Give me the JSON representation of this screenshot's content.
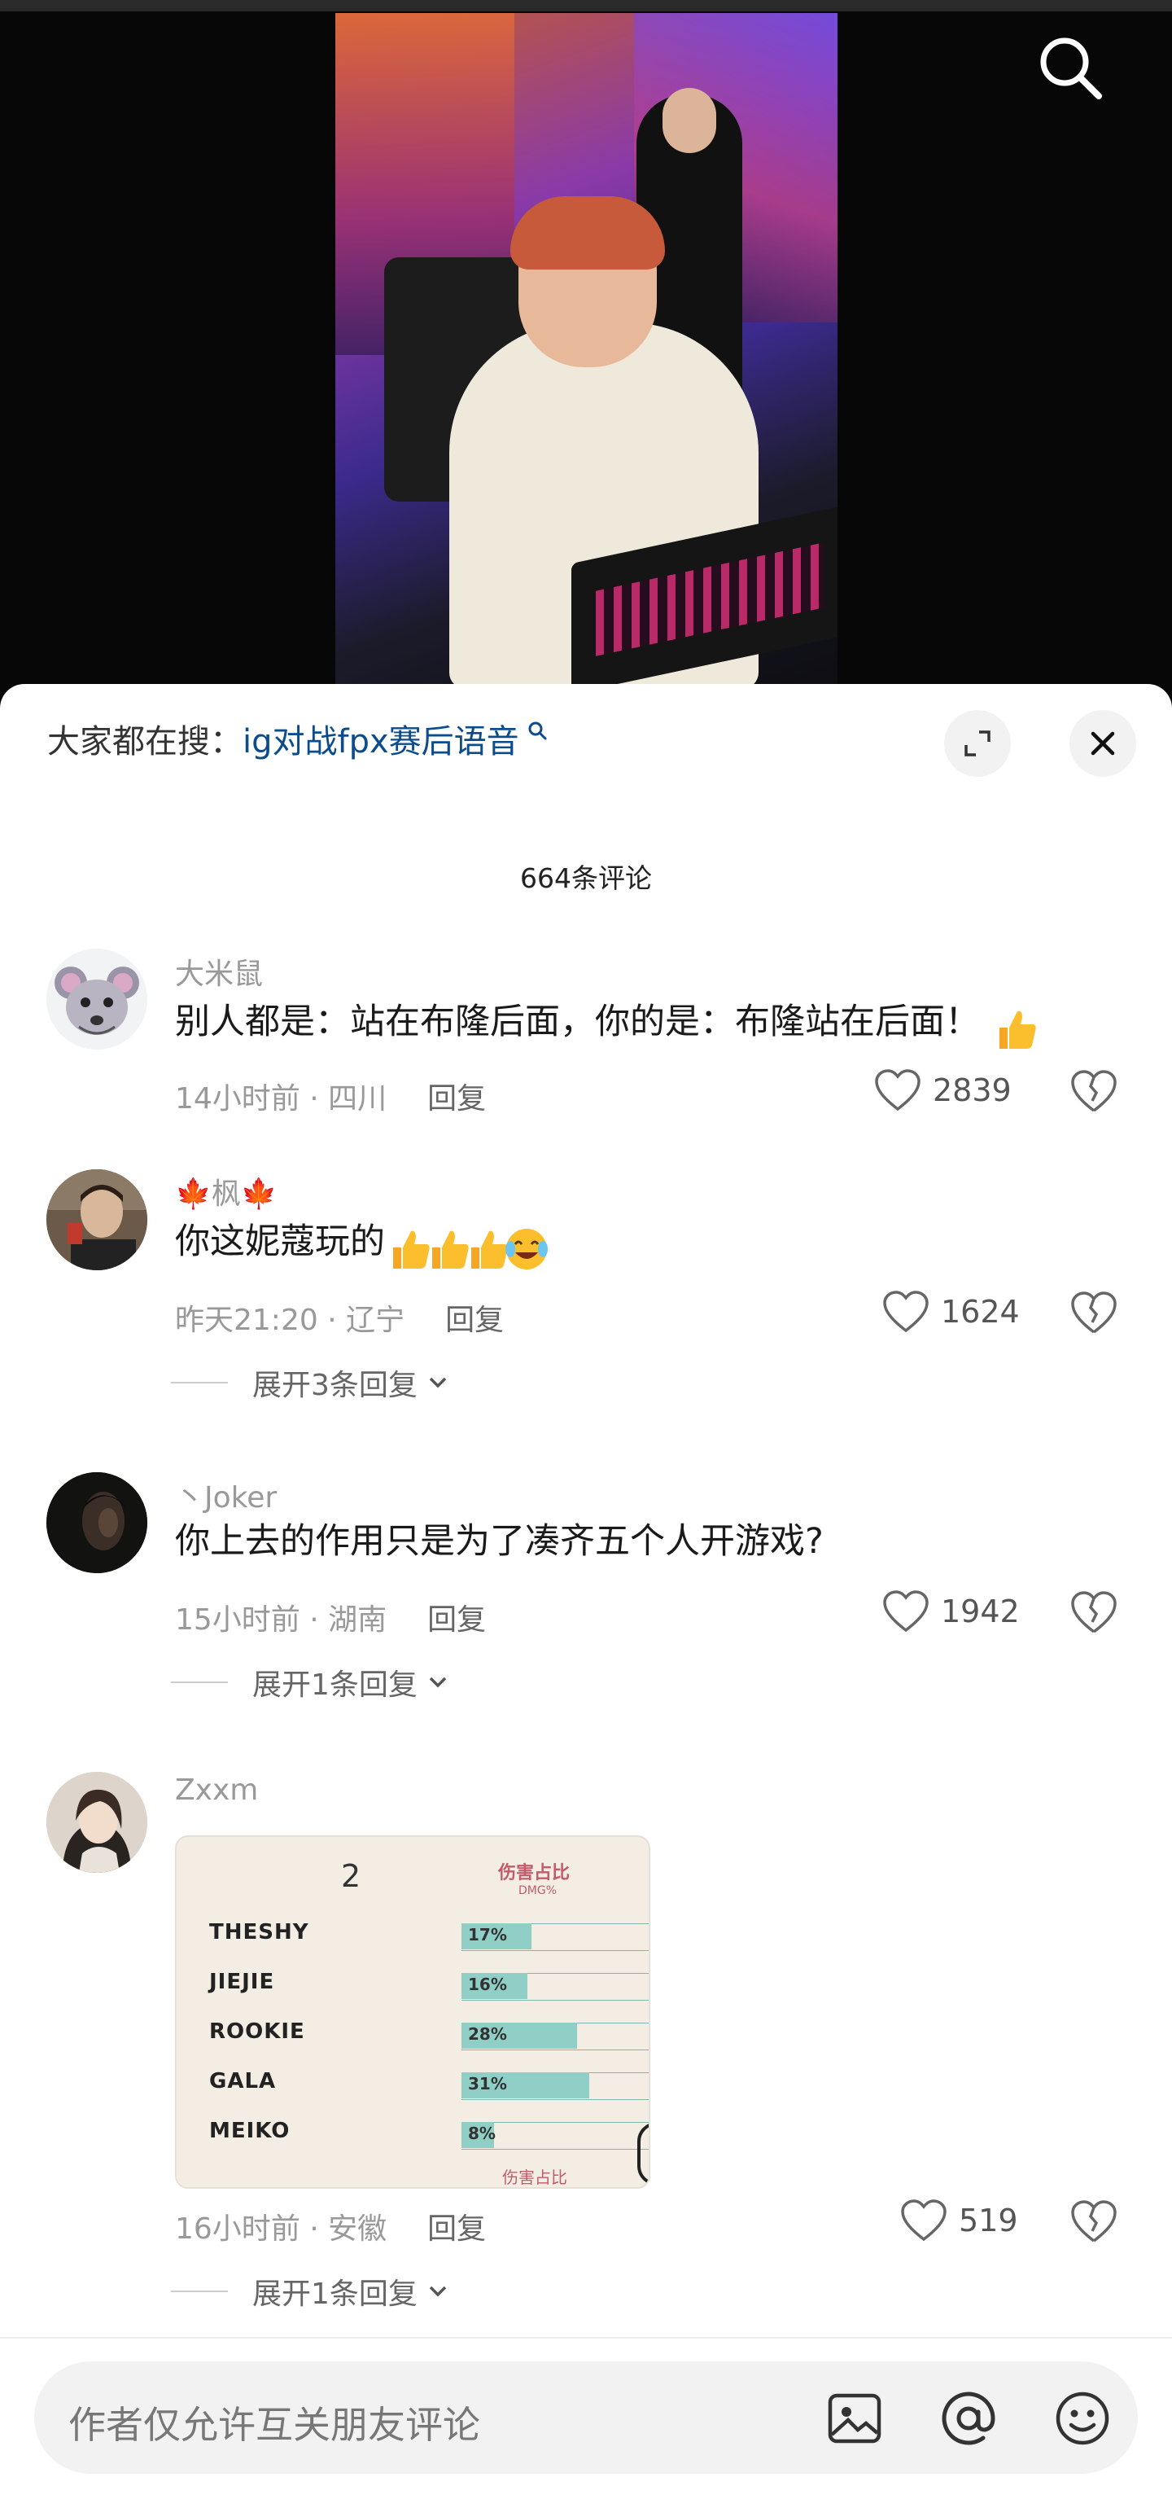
{
  "video": {
    "search_icon": "search-icon"
  },
  "panel": {
    "hot_search_prefix": "大家都在搜：",
    "hot_search_term": "ig对战fpx赛后语音",
    "expand_icon": "expand-icon",
    "close_icon": "close-icon",
    "comment_count": "664条评论"
  },
  "comments": [
    {
      "username": "大米鼠",
      "text": "别人都是：站在布隆后面，你的是：布隆站在后面！",
      "time": "14小时前 · 四川",
      "reply_label": "回复",
      "likes": "2839"
    },
    {
      "username": "枫",
      "text": "你这妮蔻玩的",
      "time": "昨天21:20 · 辽宁",
      "reply_label": "回复",
      "likes": "1624",
      "expand_label": "展开3条回复"
    },
    {
      "username": "丶Joker",
      "text": "你上去的作用只是为了凑齐五个人开游戏?",
      "time": "15小时前 · 湖南",
      "reply_label": "回复",
      "likes": "1942",
      "expand_label": "展开1条回复"
    },
    {
      "username": "Zxxm",
      "time": "16小时前 · 安徽",
      "reply_label": "回复",
      "likes": "519",
      "expand_label": "展开1条回复",
      "image": {
        "number": "2",
        "header": "伤害占比",
        "header_sub": "DMG%",
        "footer": "伤害占比",
        "rows": [
          {
            "name": "THESHY",
            "pct": "17%",
            "value": 17
          },
          {
            "name": "JIEJIE",
            "pct": "16%",
            "value": 16
          },
          {
            "name": "ROOKIE",
            "pct": "28%",
            "value": 28
          },
          {
            "name": "GALA",
            "pct": "31%",
            "value": 31
          },
          {
            "name": "MEIKO",
            "pct": "8%",
            "value": 8
          }
        ]
      }
    }
  ],
  "input": {
    "placeholder": "作者仅允许互关朋友评论",
    "image_icon": "image-icon",
    "mention_icon": "at-icon",
    "emoji_icon": "emoji-icon"
  }
}
